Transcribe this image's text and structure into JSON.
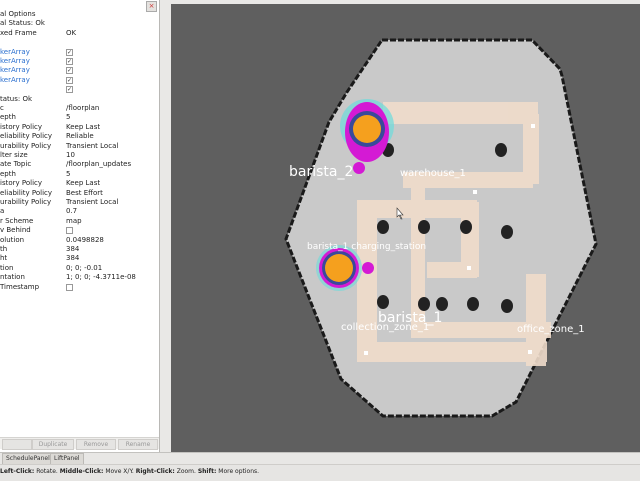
{
  "left_panel": {
    "close_glyph": "×",
    "rows": [
      {
        "key": "al Options",
        "value": "",
        "style": "plain"
      },
      {
        "key": "al Status: Ok",
        "value": "",
        "style": "plain"
      },
      {
        "key": "xed Frame",
        "value": "OK",
        "style": "plain"
      },
      {
        "key": "",
        "value": "",
        "style": "plain"
      },
      {
        "key": "kerArray",
        "check": true,
        "style": "blue"
      },
      {
        "key": "kerArray",
        "check": true,
        "style": "blue"
      },
      {
        "key": "kerArray",
        "check": true,
        "style": "blue"
      },
      {
        "key": "kerArray",
        "check": true,
        "style": "blue"
      },
      {
        "key": "",
        "check": true,
        "style": "blue"
      },
      {
        "key": "tatus: Ok",
        "value": "",
        "style": "plain"
      },
      {
        "key": "c",
        "value": "/floorplan",
        "style": "plain"
      },
      {
        "key": "epth",
        "value": "5",
        "style": "plain"
      },
      {
        "key": "istory Policy",
        "value": "Keep Last",
        "style": "plain"
      },
      {
        "key": "eliability Policy",
        "value": "Reliable",
        "style": "plain"
      },
      {
        "key": "urability Policy",
        "value": "Transient Local",
        "style": "plain"
      },
      {
        "key": "lter size",
        "value": "10",
        "style": "plain"
      },
      {
        "key": "ate Topic",
        "value": "/floorplan_updates",
        "style": "plain"
      },
      {
        "key": "epth",
        "value": "5",
        "style": "plain"
      },
      {
        "key": "istory Policy",
        "value": "Keep Last",
        "style": "plain"
      },
      {
        "key": "eliability Policy",
        "value": "Best Effort",
        "style": "plain"
      },
      {
        "key": "urability Policy",
        "value": "Transient Local",
        "style": "plain"
      },
      {
        "key": "a",
        "value": "0.7",
        "style": "plain"
      },
      {
        "key": "r Scheme",
        "value": "map",
        "style": "plain"
      },
      {
        "key": "v Behind",
        "check": false,
        "style": "plain"
      },
      {
        "key": "olution",
        "value": "0.0498828",
        "style": "plain"
      },
      {
        "key": "th",
        "value": "384",
        "style": "plain"
      },
      {
        "key": "ht",
        "value": "384",
        "style": "plain"
      },
      {
        "key": "tion",
        "value": "0; 0; -0.01",
        "style": "plain"
      },
      {
        "key": "ntation",
        "value": "1; 0; 0; -4.3711e-08",
        "style": "plain"
      },
      {
        "key": "Timestamp",
        "check": false,
        "style": "plain"
      }
    ],
    "buttons": [
      "",
      "Duplicate",
      "Remove",
      "Rename"
    ]
  },
  "tabs": [
    "SchedulePanel",
    "LiftPanel"
  ],
  "status_bar": {
    "bold1": "Left-Click:",
    "t1": " Rotate. ",
    "bold2": "Middle-Click:",
    "t2": " Move X/Y. ",
    "bold3": "Right-Click:",
    "t3": " Zoom. ",
    "bold4": "Shift:",
    "t4": " More options."
  },
  "map": {
    "labels": {
      "barista_2": "barista_2",
      "warehouse": "warehouse_1",
      "charging": "barista_1 charging_station",
      "barista_1": "barista_1",
      "collection": "collection_zone_1",
      "office": "office_zone_1"
    },
    "colors": {
      "wall": "#1a1a1a",
      "floor": "#c9c9c9",
      "lane": "#f0dccb",
      "robot_orange": "#f5a01e",
      "robot_magenta": "#d41ad4",
      "robot_blue": "#3a4a9a",
      "ghost": "#6cdcdc"
    }
  }
}
